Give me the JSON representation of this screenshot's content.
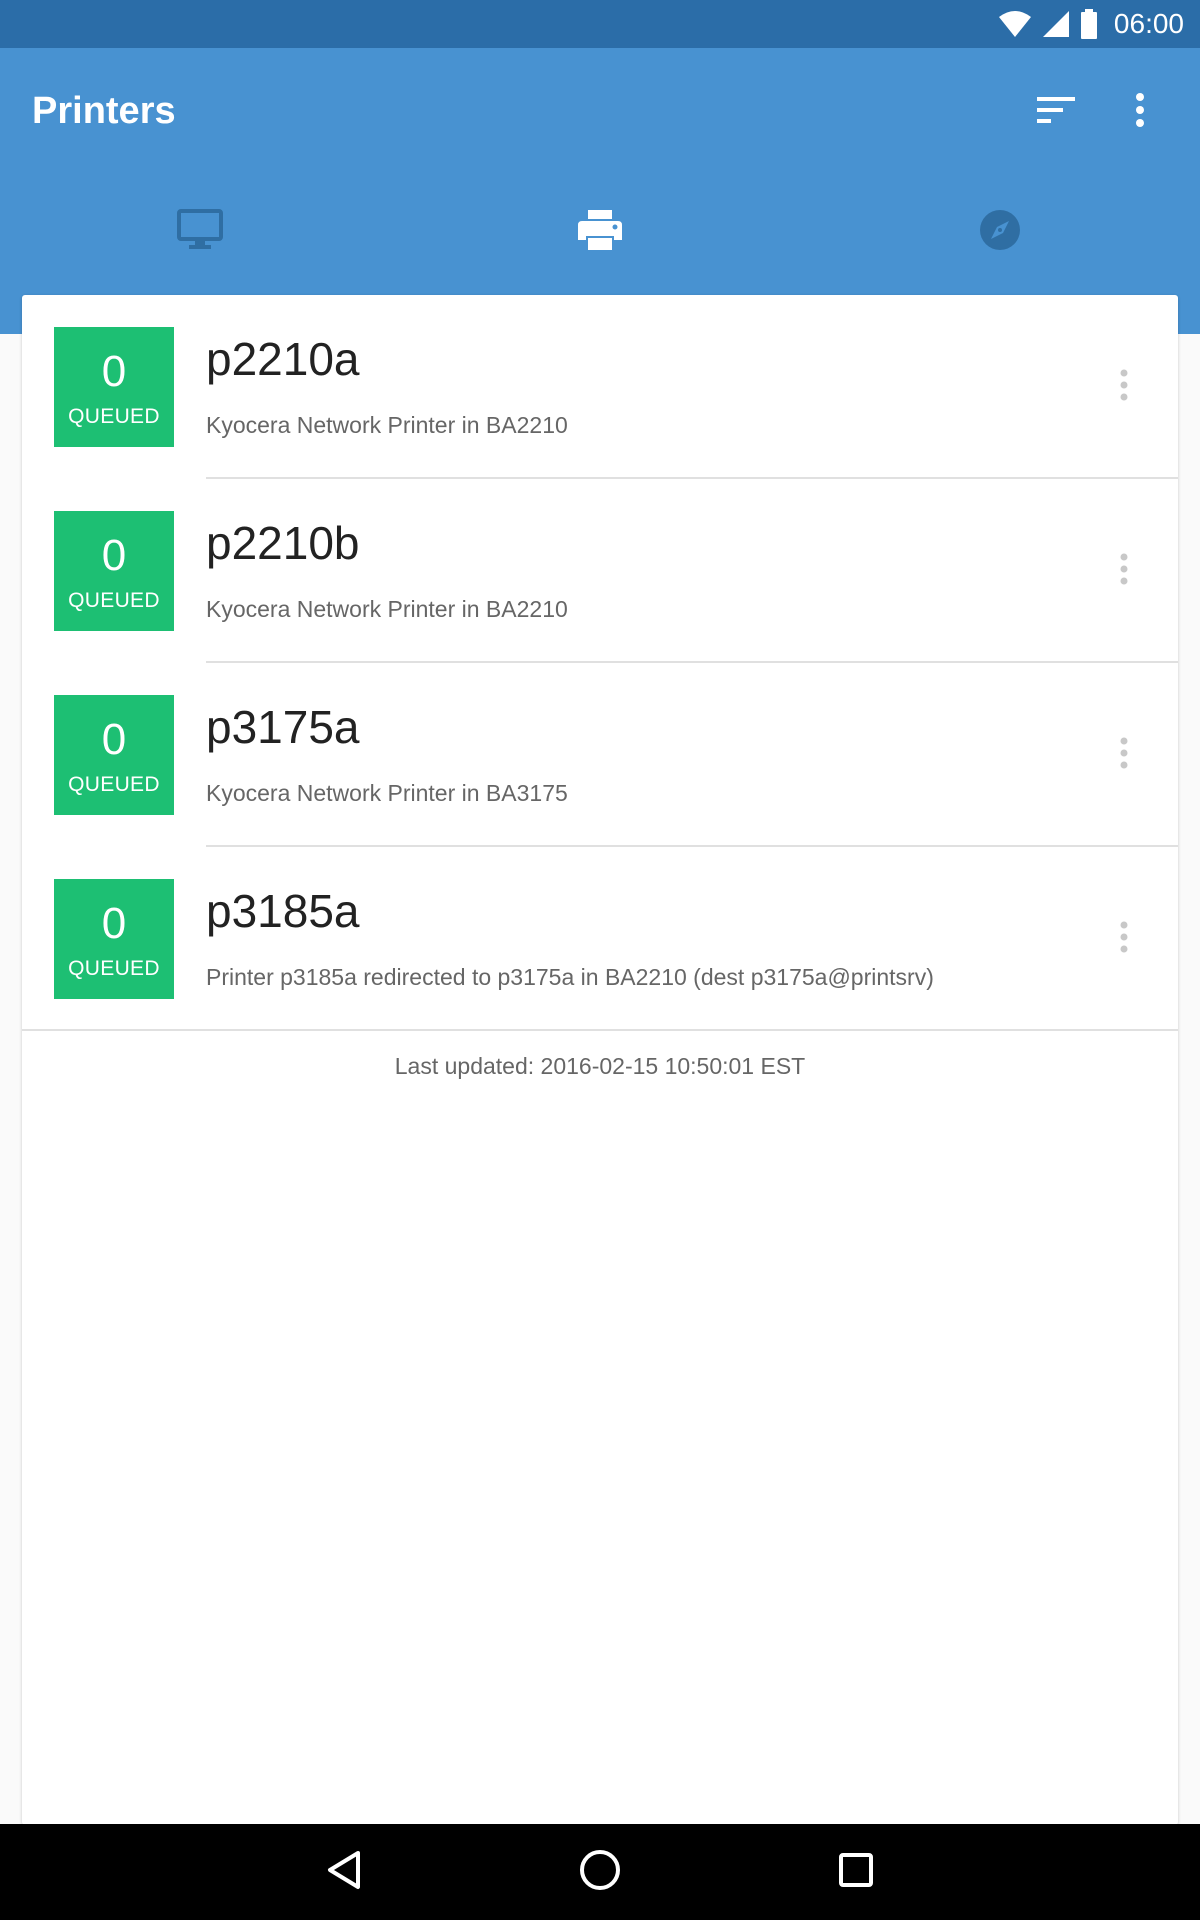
{
  "status_bar": {
    "time": "06:00",
    "icons": [
      "wifi-icon",
      "cell-signal-icon",
      "battery-icon"
    ]
  },
  "app_bar": {
    "title": "Printers",
    "actions": [
      "sort-icon",
      "more-vert-icon"
    ]
  },
  "tabs": [
    {
      "icon": "monitor-icon",
      "selected": false
    },
    {
      "icon": "printer-icon",
      "selected": true
    },
    {
      "icon": "compass-icon",
      "selected": false
    }
  ],
  "printers": [
    {
      "queued_count": "0",
      "queued_label": "QUEUED",
      "name": "p2210a",
      "description": "Kyocera Network Printer in BA2210"
    },
    {
      "queued_count": "0",
      "queued_label": "QUEUED",
      "name": "p2210b",
      "description": "Kyocera Network Printer in BA2210"
    },
    {
      "queued_count": "0",
      "queued_label": "QUEUED",
      "name": "p3175a",
      "description": "Kyocera Network Printer in BA3175"
    },
    {
      "queued_count": "0",
      "queued_label": "QUEUED",
      "name": "p3185a",
      "description": "Printer p3185a redirected to p3175a in BA2210 (dest p3175a@printsrv)"
    }
  ],
  "last_updated": "Last updated: 2016-02-15 10:50:01 EST",
  "colors": {
    "status_bar": "#2b6da8",
    "app_bar": "#4892d1",
    "tab_indicator": "#8bc34a",
    "queue_box": "#1dbf73",
    "tab_icon_inactive": "#2f6ea3"
  },
  "nav_bar": [
    "back-icon",
    "home-icon",
    "recents-icon"
  ]
}
